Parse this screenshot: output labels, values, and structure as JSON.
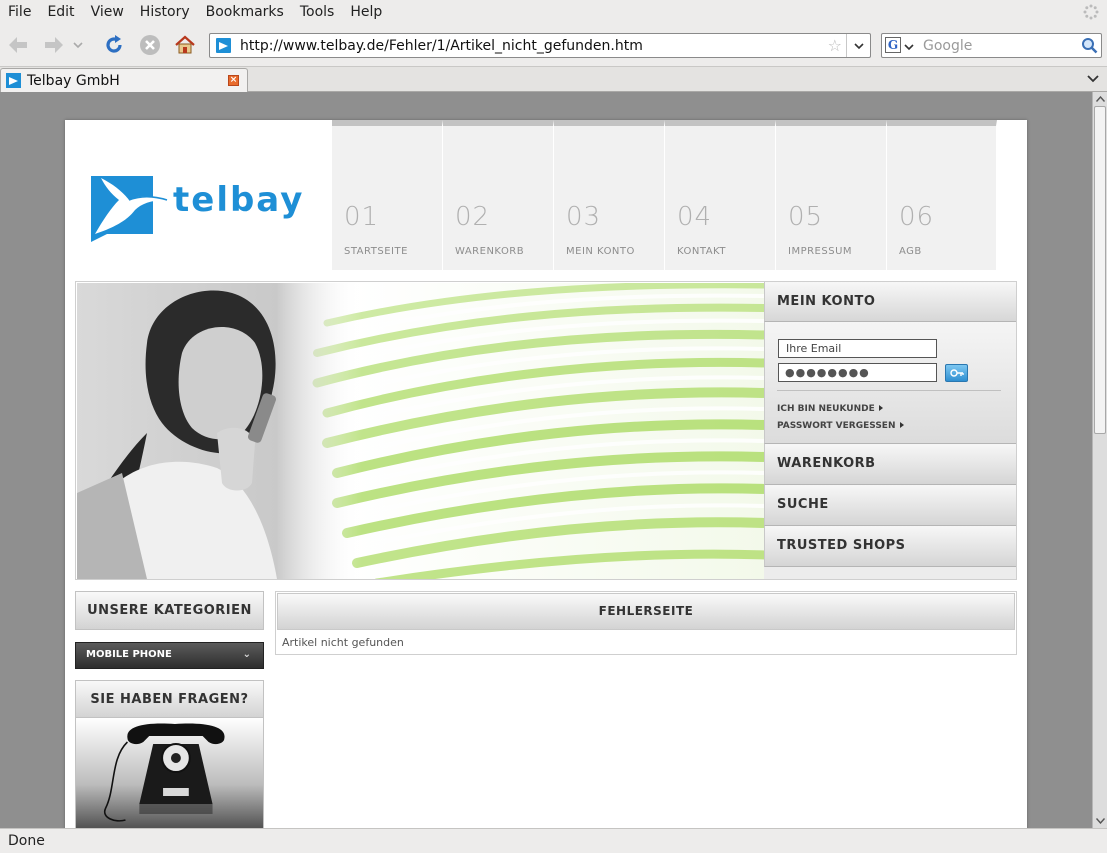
{
  "browser": {
    "menu": [
      "File",
      "Edit",
      "View",
      "History",
      "Bookmarks",
      "Tools",
      "Help"
    ],
    "url": "http://www.telbay.de/Fehler/1/Artikel_nicht_gefunden.htm",
    "search_placeholder": "Google",
    "tab_title": "Telbay GmbH",
    "status": "Done"
  },
  "site": {
    "logo_text": "telbay",
    "nav": [
      {
        "num": "01",
        "label": "STARTSEITE"
      },
      {
        "num": "02",
        "label": "WARENKORB"
      },
      {
        "num": "03",
        "label": "MEIN KONTO"
      },
      {
        "num": "04",
        "label": "KONTAKT"
      },
      {
        "num": "05",
        "label": "IMPRESSUM"
      },
      {
        "num": "06",
        "label": "AGB"
      }
    ],
    "account": {
      "title": "MEIN KONTO",
      "email_placeholder": "Ihre Email",
      "password_mask": "●●●●●●●●",
      "new_customer": "ICH BIN NEUKUNDE",
      "forgot_password": "PASSWORT VERGESSEN"
    },
    "side_items": [
      "WARENKORB",
      "SUCHE",
      "TRUSTED SHOPS"
    ],
    "categories_title": "UNSERE KATEGORIEN",
    "category_selected": "MOBILE PHONE",
    "questions_title": "SIE HABEN FRAGEN?",
    "content_title": "FEHLERSEITE",
    "content_message": "Artikel nicht gefunden"
  },
  "colors": {
    "brand": "#1e8fd6",
    "accent_green": "#a6d85a"
  }
}
